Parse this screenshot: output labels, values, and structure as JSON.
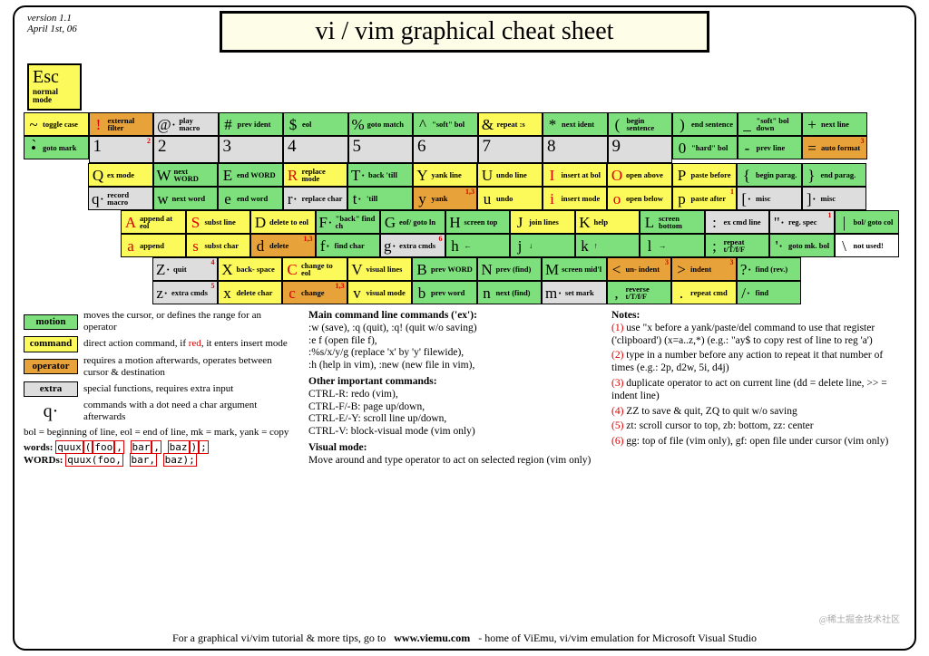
{
  "meta": {
    "version": "version 1.1",
    "date": "April 1st, 06"
  },
  "title": "vi / vim graphical cheat sheet",
  "esc": {
    "key": "Esc",
    "desc": "normal mode"
  },
  "rows": [
    [
      {
        "t": [
          [
            "~",
            "toggle case",
            "command"
          ],
          [
            "•̀",
            "goto mark",
            "motion"
          ]
        ]
      },
      {
        "t": [
          [
            "!",
            "external filter",
            "operator",
            "r"
          ],
          [
            "1",
            "",
            "numsub",
            "",
            "2"
          ]
        ]
      },
      {
        "t": [
          [
            "@·",
            "play macro",
            "extra"
          ],
          [
            "2",
            "",
            "numsub"
          ]
        ]
      },
      {
        "t": [
          [
            "#",
            "prev ident",
            "motion"
          ],
          [
            "3",
            "",
            "numsub"
          ]
        ]
      },
      {
        "t": [
          [
            "$",
            "eol",
            "motion"
          ],
          [
            "4",
            "",
            "numsub"
          ]
        ]
      },
      {
        "t": [
          [
            "%",
            "goto match",
            "motion"
          ],
          [
            "5",
            "",
            "numsub"
          ]
        ]
      },
      {
        "t": [
          [
            "^",
            "\"soft\" bol",
            "motion"
          ],
          [
            "6",
            "",
            "numsub"
          ]
        ]
      },
      {
        "t": [
          [
            "&",
            "repeat :s",
            "command"
          ],
          [
            "7",
            "",
            "numsub"
          ]
        ]
      },
      {
        "t": [
          [
            "*",
            "next ident",
            "motion"
          ],
          [
            "8",
            "",
            "numsub"
          ]
        ]
      },
      {
        "t": [
          [
            "(",
            "begin sentence",
            "motion"
          ],
          [
            "9",
            "",
            "numsub"
          ]
        ]
      },
      {
        "t": [
          [
            ")",
            "end sentence",
            "motion"
          ],
          [
            "0",
            "\"hard\" bol",
            "motion"
          ]
        ]
      },
      {
        "t": [
          [
            "_",
            "\"soft\" bol down",
            "motion"
          ],
          [
            "-",
            "prev line",
            "motion"
          ]
        ]
      },
      {
        "t": [
          [
            "+",
            "next line",
            "motion"
          ],
          [
            "=",
            "auto format",
            "operator",
            "",
            "3"
          ]
        ]
      }
    ],
    [
      {
        "t": [
          [
            "Q",
            "ex mode",
            "command"
          ],
          [
            "q·",
            "record macro",
            "extra"
          ]
        ]
      },
      {
        "t": [
          [
            "W",
            "next WORD",
            "motion"
          ],
          [
            "w",
            "next word",
            "motion"
          ]
        ]
      },
      {
        "t": [
          [
            "E",
            "end WORD",
            "motion"
          ],
          [
            "e",
            "end word",
            "motion"
          ]
        ]
      },
      {
        "t": [
          [
            "R",
            "replace mode",
            "command",
            "r"
          ],
          [
            "r·",
            "replace char",
            "extra"
          ]
        ]
      },
      {
        "t": [
          [
            "T·",
            "back 'till",
            "motion"
          ],
          [
            "t·",
            "'till",
            "motion"
          ]
        ]
      },
      {
        "t": [
          [
            "Y",
            "yank line",
            "command"
          ],
          [
            "y",
            "yank",
            "operator",
            "",
            "1,3"
          ]
        ]
      },
      {
        "t": [
          [
            "U",
            "undo line",
            "command"
          ],
          [
            "u",
            "undo",
            "command"
          ]
        ]
      },
      {
        "t": [
          [
            "I",
            "insert at bol",
            "command",
            "r"
          ],
          [
            "i",
            "insert mode",
            "command",
            "r"
          ]
        ]
      },
      {
        "t": [
          [
            "O",
            "open above",
            "command",
            "r"
          ],
          [
            "o",
            "open below",
            "command",
            "r"
          ]
        ]
      },
      {
        "t": [
          [
            "P",
            "paste before",
            "command"
          ],
          [
            "p",
            "paste after",
            "command",
            "",
            "1"
          ]
        ]
      },
      {
        "t": [
          [
            "{",
            "begin parag.",
            "motion"
          ],
          [
            "[·",
            "misc",
            "extra"
          ]
        ]
      },
      {
        "t": [
          [
            "}",
            "end parag.",
            "motion"
          ],
          [
            "]·",
            "misc",
            "extra"
          ]
        ]
      }
    ],
    [
      {
        "t": [
          [
            "A",
            "append at eol",
            "command",
            "r"
          ],
          [
            "a",
            "append",
            "command",
            "r"
          ]
        ]
      },
      {
        "t": [
          [
            "S",
            "subst line",
            "command",
            "r"
          ],
          [
            "s",
            "subst char",
            "command",
            "r"
          ]
        ]
      },
      {
        "t": [
          [
            "D",
            "delete to eol",
            "command"
          ],
          [
            "d",
            "delete",
            "operator",
            "",
            "1,3"
          ]
        ]
      },
      {
        "t": [
          [
            "F·",
            "\"back\" find ch",
            "motion"
          ],
          [
            "f·",
            "find char",
            "motion"
          ]
        ]
      },
      {
        "t": [
          [
            "G",
            "eof/ goto ln",
            "motion"
          ],
          [
            "g·",
            "extra cmds",
            "extra",
            "",
            "6"
          ]
        ]
      },
      {
        "t": [
          [
            "H",
            "screen top",
            "motion"
          ],
          [
            "h",
            "←",
            "motion",
            "arrow"
          ]
        ]
      },
      {
        "t": [
          [
            "J",
            "join lines",
            "command"
          ],
          [
            "j",
            "↓",
            "motion",
            "arrow"
          ]
        ]
      },
      {
        "t": [
          [
            "K",
            "help",
            "command"
          ],
          [
            "k",
            "↑",
            "motion",
            "arrow"
          ]
        ]
      },
      {
        "t": [
          [
            "L",
            "screen bottom",
            "motion"
          ],
          [
            "l",
            "→",
            "motion",
            "arrow"
          ]
        ]
      },
      {
        "t": [
          [
            ":",
            "ex cmd line",
            "extra"
          ],
          [
            ";",
            "repeat t/T/f/F",
            "motion"
          ]
        ]
      },
      {
        "t": [
          [
            "\"·",
            "reg. spec",
            "extra",
            "",
            "1"
          ],
          [
            "'·",
            "goto mk. bol",
            "motion"
          ]
        ]
      },
      {
        "t": [
          [
            "|",
            "bol/ goto col",
            "motion"
          ],
          [
            "\\",
            "not used!",
            "unused"
          ]
        ]
      }
    ],
    [
      {
        "t": [
          [
            "Z·",
            "quit",
            "extra",
            "",
            "4"
          ],
          [
            "z·",
            "extra cmds",
            "extra",
            "",
            "5"
          ]
        ]
      },
      {
        "t": [
          [
            "X",
            "back- space",
            "command"
          ],
          [
            "x",
            "delete char",
            "command"
          ]
        ]
      },
      {
        "t": [
          [
            "C",
            "change to eol",
            "command",
            "r"
          ],
          [
            "c",
            "change",
            "operator",
            "r",
            "1,3"
          ]
        ]
      },
      {
        "t": [
          [
            "V",
            "visual lines",
            "command"
          ],
          [
            "v",
            "visual mode",
            "command"
          ]
        ]
      },
      {
        "t": [
          [
            "B",
            "prev WORD",
            "motion"
          ],
          [
            "b",
            "prev word",
            "motion"
          ]
        ]
      },
      {
        "t": [
          [
            "N",
            "prev (find)",
            "motion"
          ],
          [
            "n",
            "next (find)",
            "motion"
          ]
        ]
      },
      {
        "t": [
          [
            "M",
            "screen mid'l",
            "motion"
          ],
          [
            "m·",
            "set mark",
            "extra"
          ]
        ]
      },
      {
        "t": [
          [
            "<",
            "un- indent",
            "operator",
            "",
            "3"
          ],
          [
            ",",
            "reverse t/T/f/F",
            "motion"
          ]
        ]
      },
      {
        "t": [
          [
            ">",
            "indent",
            "operator",
            "",
            "3"
          ],
          [
            ".",
            "repeat cmd",
            "command"
          ]
        ]
      },
      {
        "t": [
          [
            "?·",
            "find (rev.)",
            "motion"
          ],
          [
            "/·",
            "find",
            "motion"
          ]
        ]
      }
    ]
  ],
  "legend": [
    {
      "cls": "motion",
      "name": "motion",
      "txt": "moves the cursor, or defines the range for an operator"
    },
    {
      "cls": "command",
      "name": "command",
      "txt": "direct action command, if <span class='red'>red</span>, it enters insert mode"
    },
    {
      "cls": "operator",
      "name": "operator",
      "txt": "requires a motion afterwards, operates between cursor & destination"
    },
    {
      "cls": "extra",
      "name": "extra",
      "txt": "special functions, requires extra input"
    }
  ],
  "qdot": {
    "sym": "q·",
    "txt": "commands with a dot need a char argument afterwards"
  },
  "abbr": "bol = beginning of line, eol = end of line, mk = mark, yank = copy",
  "wordex": {
    "words_label": "words:",
    "WORDS_label": "WORDs:",
    "sample": "quux(foo, bar, baz);"
  },
  "col2": {
    "h1": "Main command line commands ('ex'):",
    "t1": ":w (save), :q (quit), :q! (quit w/o saving)\n:e f (open file f),\n:%s/x/y/g (replace 'x' by 'y' filewide),\n:h (help in vim), :new (new file in vim),",
    "h2": "Other important commands:",
    "t2": "CTRL-R: redo (vim),\nCTRL-F/-B: page up/down,\nCTRL-E/-Y: scroll line up/down,\nCTRL-V: block-visual mode (vim only)",
    "h3": "Visual mode:",
    "t3": "Move around and type operator to act on selected region (vim only)"
  },
  "notes": {
    "h": "Notes:",
    "items": [
      "use \"x before a yank/paste/del command to use that register ('clipboard') (x=a..z,*) (e.g.: \"ay$ to copy rest of line to reg 'a')",
      "type in a number before any action to repeat it that number of times (e.g.: 2p, d2w, 5i, d4j)",
      "duplicate operator to act on current line (dd = delete line, >> = indent line)",
      "ZZ to save & quit, ZQ to quit w/o saving",
      "zt: scroll cursor to top, zb: bottom, zz: center",
      "gg: top of file (vim only), gf: open file under cursor (vim only)"
    ]
  },
  "footer": "For a graphical vi/vim tutorial & more tips, go to   www.viemu.com   - home of ViEmu, vi/vim emulation for Microsoft Visual Studio",
  "watermark": "@稀土掘金技术社区"
}
